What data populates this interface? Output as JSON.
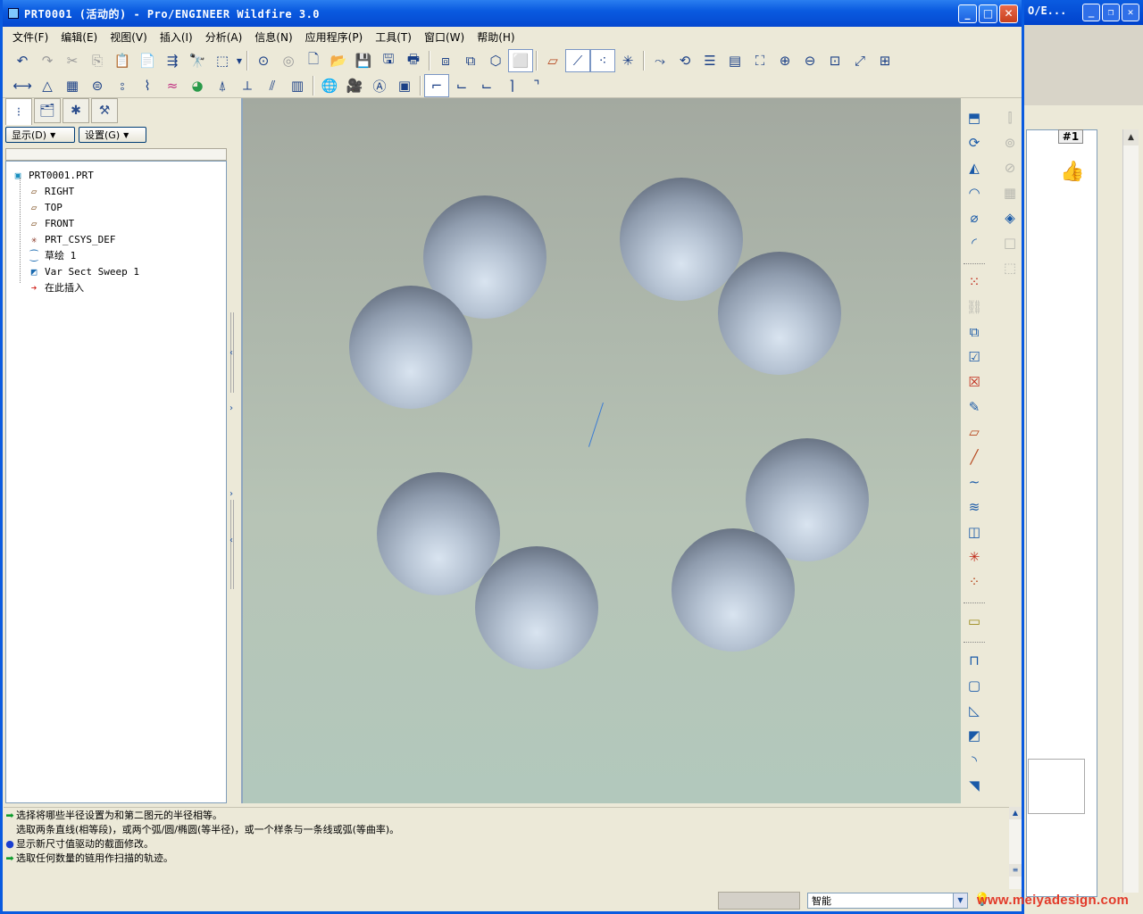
{
  "window": {
    "title": "PRT0001 (活动的) - Pro/ENGINEER Wildfire 3.0",
    "minimize": "_",
    "maximize": "□",
    "close": "✕"
  },
  "background_window": {
    "title": "O/E...",
    "badge": "#1"
  },
  "menu": [
    "文件(F)",
    "编辑(E)",
    "视图(V)",
    "插入(I)",
    "分析(A)",
    "信息(N)",
    "应用程序(P)",
    "工具(T)",
    "窗口(W)",
    "帮助(H)"
  ],
  "navigator": {
    "show_button": "显示(D)",
    "settings_button": "设置(G)",
    "tree": [
      {
        "label": "PRT0001.PRT",
        "icon": "part-icon",
        "level": 0
      },
      {
        "label": "RIGHT",
        "icon": "datum-plane-icon",
        "level": 1
      },
      {
        "label": "TOP",
        "icon": "datum-plane-icon",
        "level": 1
      },
      {
        "label": "FRONT",
        "icon": "datum-plane-icon",
        "level": 1
      },
      {
        "label": "PRT_CSYS_DEF",
        "icon": "csys-icon",
        "level": 1
      },
      {
        "label": "草绘 1",
        "icon": "sketch-icon",
        "level": 1
      },
      {
        "label": "Var Sect Sweep 1",
        "icon": "sweep-icon",
        "level": 1
      },
      {
        "label": "在此插入",
        "icon": "insert-here-arrow-icon",
        "level": 1
      }
    ]
  },
  "messages": [
    {
      "type": "prompt",
      "text": "选择将哪些半径设置为和第二图元的半径相等。"
    },
    {
      "type": "plain",
      "text": "选取两条直线(相等段)，或两个弧/圆/椭圆(等半径)，或一个样条与一条线或弧(等曲率)。"
    },
    {
      "type": "info",
      "text": "显示新尺寸值驱动的截面修改。"
    },
    {
      "type": "prompt",
      "text": "选取任何数量的链用作扫描的轨迹。"
    }
  ],
  "status": {
    "filter": "智能"
  },
  "watermark": "www.meiyadesign.com"
}
